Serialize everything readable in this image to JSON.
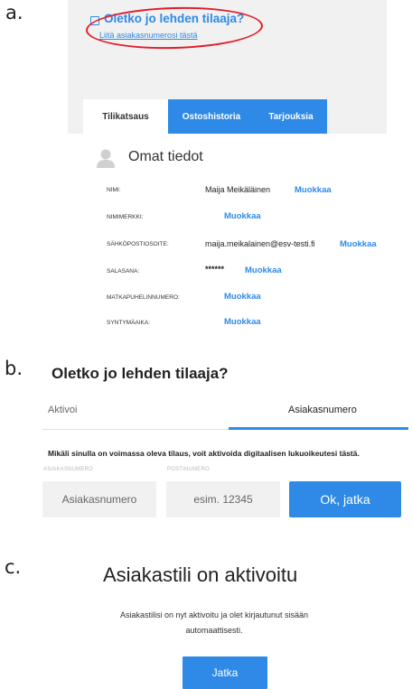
{
  "labels": {
    "a": "a.",
    "b": "b.",
    "c": "c."
  },
  "panel_a": {
    "title": "Oletko jo lehden tilaaja?",
    "link": "Liitä asiakasnumerosi tästä",
    "tabs": [
      "Tilikatsaus",
      "Ostoshistoria",
      "Tarjouksia"
    ],
    "section_title": "Omat tiedot",
    "edit_label": "Muokkaa",
    "fields": [
      {
        "label": "NIMI:",
        "value": "Maija Meikäläinen"
      },
      {
        "label": "NIMIMERKKI:",
        "value": ""
      },
      {
        "label": "SÄHKÖPOSTIOSOITE:",
        "value": "maija.meikalainen@esv-testi.fi"
      },
      {
        "label": "SALASANA:",
        "value": "******"
      },
      {
        "label": "MATKAPUHELINNUMERO:",
        "value": ""
      },
      {
        "label": "SYNTYMÄAIKA:",
        "value": ""
      }
    ],
    "accent": "#2e8ae6",
    "highlight": "#e01e2a",
    "icons": [
      "checkbox-icon",
      "user-icon"
    ]
  },
  "panel_b": {
    "title": "Oletko jo lehden tilaaja?",
    "tabs": [
      "Aktivoi",
      "Asiakasnumero"
    ],
    "active_tab": "Asiakasnumero",
    "description": "Mikäli sinulla on voimassa oleva tilaus, voit aktivoida digitaalisen lukuoikeutesi tästä.",
    "customer_caption": "ASIAKASNUMERO",
    "customer_placeholder": "Asiakasnumero",
    "postal_caption": "POSTINUMERO",
    "postal_placeholder": "esim. 12345",
    "submit_label": "Ok, jatka"
  },
  "panel_c": {
    "title": "Asiakastili on aktivoitu",
    "text": "Asiakastilisi on nyt aktivoitu ja olet kirjautunut sisään automaattisesti.",
    "button_label": "Jatka"
  }
}
